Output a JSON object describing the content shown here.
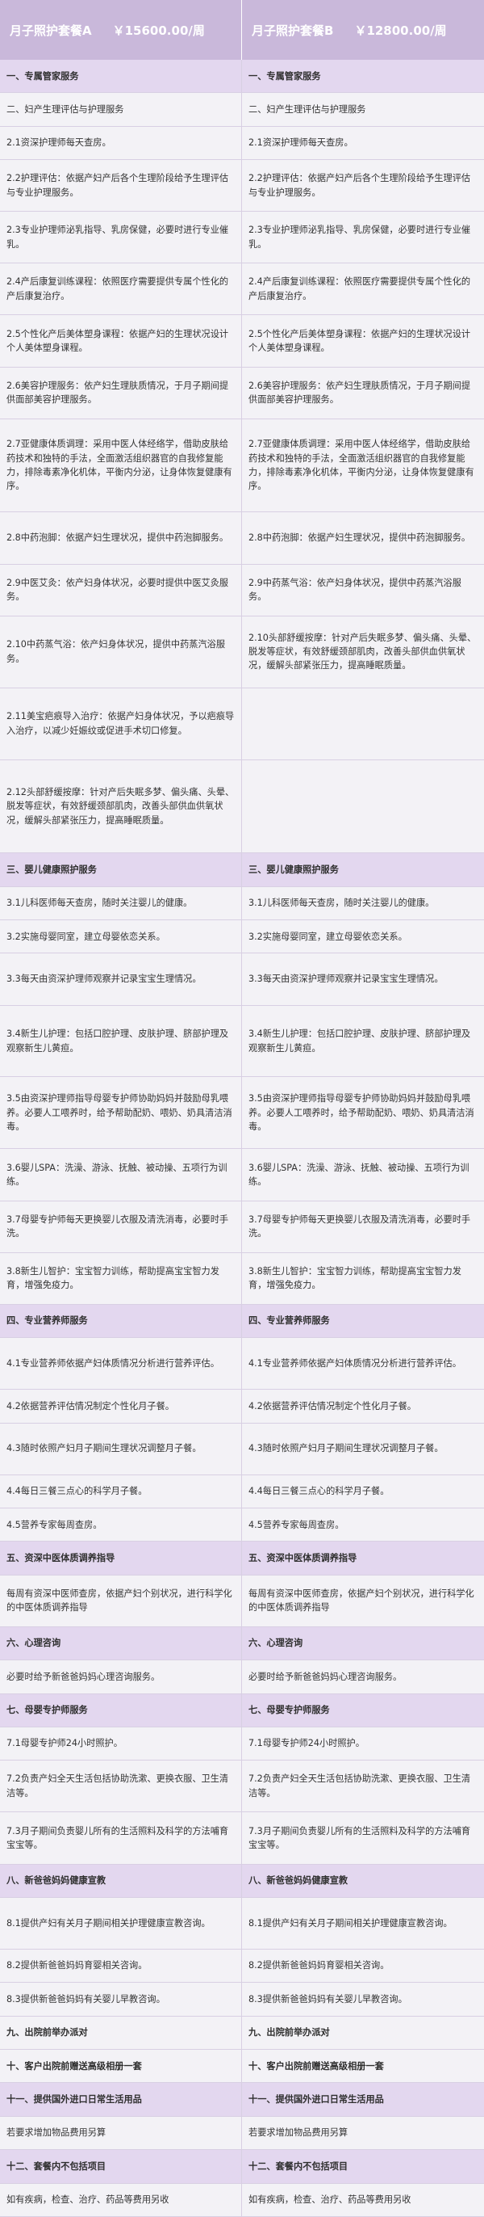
{
  "header": {
    "a_name": "月子照护套餐A",
    "a_price": "￥15600.00/周",
    "b_name": "月子照护套餐B",
    "b_price": "￥12800.00/周"
  },
  "rows": [
    {
      "kind": "sec",
      "h": "r1",
      "a": "一、专属管家服务",
      "b": "一、专属管家服务"
    },
    {
      "kind": "body",
      "h": "r1",
      "a": "二、妇产生理评估与护理服务",
      "b": "二、妇产生理评估与护理服务"
    },
    {
      "kind": "body",
      "h": "r1",
      "a": "2.1资深护理师每天查房。",
      "b": "2.1资深护理师每天查房。"
    },
    {
      "kind": "body",
      "h": "r2",
      "a": "2.2护理评估：依据产妇产后各个生理阶段给予生理评估与专业护理服务。",
      "b": "2.2护理评估：依据产妇产后各个生理阶段给予生理评估与专业护理服务。"
    },
    {
      "kind": "body",
      "h": "r2",
      "a": "2.3专业护理师泌乳指导、乳房保健，必要时进行专业催乳。",
      "b": "2.3专业护理师泌乳指导、乳房保健，必要时进行专业催乳。"
    },
    {
      "kind": "body",
      "h": "r2",
      "a": "2.4产后康复训练课程：依照医疗需要提供专属个性化的产后康复治疗。",
      "b": "2.4产后康复训练课程：依照医疗需要提供专属个性化的产后康复治疗。"
    },
    {
      "kind": "body",
      "h": "r2",
      "a": "2.5个性化产后美体塑身课程：依据产妇的生理状况设计个人美体塑身课程。",
      "b": "2.5个性化产后美体塑身课程：依据产妇的生理状况设计个人美体塑身课程。"
    },
    {
      "kind": "body",
      "h": "r2",
      "a": "2.6美容护理服务：依产妇生理肤质情况，于月子期间提供面部美容护理服务。",
      "b": "2.6美容护理服务：依产妇生理肤质情况，于月子期间提供面部美容护理服务。"
    },
    {
      "kind": "body",
      "h": "r4",
      "a": "2.7亚健康体质调理：采用中医人体经络学，借助皮肤给药技术和独特的手法，全面激活组织器官的自我修复能力，排除毒素净化机体，平衡内分泌，让身体恢复健康有序。",
      "b": "2.7亚健康体质调理：采用中医人体经络学，借助皮肤给药技术和独特的手法，全面激活组织器官的自我修复能力，排除毒素净化机体，平衡内分泌，让身体恢复健康有序。"
    },
    {
      "kind": "body",
      "h": "r2",
      "a": "2.8中药泡脚：依据产妇生理状况，提供中药泡脚服务。",
      "b": "2.8中药泡脚：依据产妇生理状况，提供中药泡脚服务。"
    },
    {
      "kind": "body",
      "h": "r2",
      "a": "2.9中医艾灸：依产妇身体状况，必要时提供中医艾灸服务。",
      "b": "2.9中药蒸气浴：依产妇身体状况，提供中药蒸汽浴服务。"
    },
    {
      "kind": "body",
      "h": "r3",
      "a": "2.10中药蒸气浴：依产妇身体状况，提供中药蒸汽浴服务。",
      "b": "2.10头部舒缓按摩：针对产后失眠多梦、偏头痛、头晕、脱发等症状，有效舒缓颈部肌肉，改善头部供血供氧状况，缓解头部紧张压力，提高睡眠质量。"
    },
    {
      "kind": "body",
      "h": "r3",
      "a": "2.11美宝疤痕导入治疗：依据产妇身体状况，予以疤痕导入治疗，以减少妊娠纹或促进手术切口修复。",
      "b": ""
    },
    {
      "kind": "body",
      "h": "r4",
      "a": "2.12头部舒缓按摩：针对产后失眠多梦、偏头痛、头晕、脱发等症状，有效舒缓颈部肌肉，改善头部供血供氧状况，缓解头部紧张压力，提高睡眠质量。",
      "b": ""
    },
    {
      "kind": "sec",
      "h": "r1",
      "a": "三、婴儿健康照护服务",
      "b": "三、婴儿健康照护服务"
    },
    {
      "kind": "body",
      "h": "r1",
      "a": "3.1儿科医师每天查房，随时关注婴儿的健康。",
      "b": "3.1儿科医师每天查房，随时关注婴儿的健康。"
    },
    {
      "kind": "body",
      "h": "r1",
      "a": "3.2实施母婴同室，建立母婴依恋关系。",
      "b": "3.2实施母婴同室，建立母婴依恋关系。"
    },
    {
      "kind": "body",
      "h": "r2",
      "a": "3.3每天由资深护理师观察并记录宝宝生理情况。",
      "b": "3.3每天由资深护理师观察并记录宝宝生理情况。"
    },
    {
      "kind": "body",
      "h": "r3",
      "a": "3.4新生儿护理：包括口腔护理、皮肤护理、脐部护理及观察新生儿黄疸。",
      "b": "3.4新生儿护理：包括口腔护理、皮肤护理、脐部护理及观察新生儿黄疸。"
    },
    {
      "kind": "body",
      "h": "r3",
      "a": "3.5由资深护理师指导母婴专护师协助妈妈并鼓励母乳喂养。必要人工喂养时，给予帮助配奶、喂奶、奶具清洁消毒。",
      "b": "3.5由资深护理师指导母婴专护师协助妈妈并鼓励母乳喂养。必要人工喂养时，给予帮助配奶、喂奶、奶具清洁消毒。"
    },
    {
      "kind": "body",
      "h": "r2",
      "a": "3.6婴儿SPA：洗澡、游泳、抚触、被动操、五项行为训练。",
      "b": "3.6婴儿SPA：洗澡、游泳、抚触、被动操、五项行为训练。"
    },
    {
      "kind": "body",
      "h": "r2",
      "a": "3.7母婴专护师每天更换婴儿衣服及清洗消毒，必要时手洗。",
      "b": "3.7母婴专护师每天更换婴儿衣服及清洗消毒，必要时手洗。"
    },
    {
      "kind": "body",
      "h": "r2",
      "a": "3.8新生儿智护：宝宝智力训练，帮助提高宝宝智力发育，增强免疫力。",
      "b": "3.8新生儿智护：宝宝智力训练，帮助提高宝宝智力发育，增强免疫力。"
    },
    {
      "kind": "sec",
      "h": "r1",
      "a": "四、专业营养师服务",
      "b": "四、专业营养师服务"
    },
    {
      "kind": "body",
      "h": "r2",
      "a": "4.1专业营养师依据产妇体质情况分析进行营养评估。",
      "b": "4.1专业营养师依据产妇体质情况分析进行营养评估。"
    },
    {
      "kind": "body",
      "h": "r1",
      "a": "4.2依据营养评估情况制定个性化月子餐。",
      "b": "4.2依据营养评估情况制定个性化月子餐。"
    },
    {
      "kind": "body",
      "h": "r2",
      "a": "4.3随时依照产妇月子期间生理状况调整月子餐。",
      "b": "4.3随时依照产妇月子期间生理状况调整月子餐。"
    },
    {
      "kind": "body",
      "h": "r1",
      "a": "4.4每日三餐三点心的科学月子餐。",
      "b": "4.4每日三餐三点心的科学月子餐。"
    },
    {
      "kind": "body",
      "h": "r1",
      "a": "4.5营养专家每周查房。",
      "b": "4.5营养专家每周查房。"
    },
    {
      "kind": "sec",
      "h": "r1",
      "a": "五、资深中医体质调养指导",
      "b": "五、资深中医体质调养指导"
    },
    {
      "kind": "body",
      "h": "r2",
      "a": "每周有资深中医师查房，依据产妇个别状况，进行科学化的中医体质调养指导",
      "b": "每周有资深中医师查房，依据产妇个别状况，进行科学化的中医体质调养指导"
    },
    {
      "kind": "sec",
      "h": "r1",
      "a": "六、心理咨询",
      "b": "六、心理咨询"
    },
    {
      "kind": "body",
      "h": "r1",
      "a": "必要时给予新爸爸妈妈心理咨询服务。",
      "b": "必要时给予新爸爸妈妈心理咨询服务。"
    },
    {
      "kind": "sec",
      "h": "r1",
      "a": "七、母婴专护师服务",
      "b": "七、母婴专护师服务"
    },
    {
      "kind": "body",
      "h": "r1",
      "a": "7.1母婴专护师24小时照护。",
      "b": "7.1母婴专护师24小时照护。"
    },
    {
      "kind": "body",
      "h": "r2",
      "a": "7.2负责产妇全天生活包括协助洗漱、更换衣服、卫生清洁等。",
      "b": "7.2负责产妇全天生活包括协助洗漱、更换衣服、卫生清洁等。"
    },
    {
      "kind": "body",
      "h": "r2",
      "a": "7.3月子期间负责婴儿所有的生活照料及科学的方法哺育宝宝等。",
      "b": "7.3月子期间负责婴儿所有的生活照料及科学的方法哺育宝宝等。"
    },
    {
      "kind": "sec",
      "h": "r1",
      "a": "八、新爸爸妈妈健康宣教",
      "b": "八、新爸爸妈妈健康宣教"
    },
    {
      "kind": "body",
      "h": "r2",
      "a": "8.1提供产妇有关月子期间相关护理健康宣教咨询。",
      "b": "8.1提供产妇有关月子期间相关护理健康宣教咨询。"
    },
    {
      "kind": "body",
      "h": "r1",
      "a": "8.2提供新爸爸妈妈育婴相关咨询。",
      "b": "8.2提供新爸爸妈妈育婴相关咨询。"
    },
    {
      "kind": "body",
      "h": "r1",
      "a": "8.3提供新爸爸妈妈有关婴儿早教咨询。",
      "b": "8.3提供新爸爸妈妈有关婴儿早教咨询。"
    },
    {
      "kind": "sec light",
      "h": "r1",
      "a": "九、出院前举办派对",
      "b": "九、出院前举办派对"
    },
    {
      "kind": "sec light",
      "h": "r1",
      "a": "十、客户出院前赠送高级相册一套",
      "b": "十、客户出院前赠送高级相册一套"
    },
    {
      "kind": "sec",
      "h": "r1",
      "a": "十一、提供国外进口日常生活用品",
      "b": "十一、提供国外进口日常生活用品"
    },
    {
      "kind": "body",
      "h": "r1",
      "a": "若要求增加物品费用另算",
      "b": "若要求增加物品费用另算"
    },
    {
      "kind": "sec",
      "h": "r1",
      "a": "十二、套餐内不包括项目",
      "b": "十二、套餐内不包括项目"
    },
    {
      "kind": "body",
      "h": "r1",
      "a": "如有疾病，检查、治疗、药品等费用另收",
      "b": "如有疾病，检查、治疗、药品等费用另收"
    }
  ]
}
